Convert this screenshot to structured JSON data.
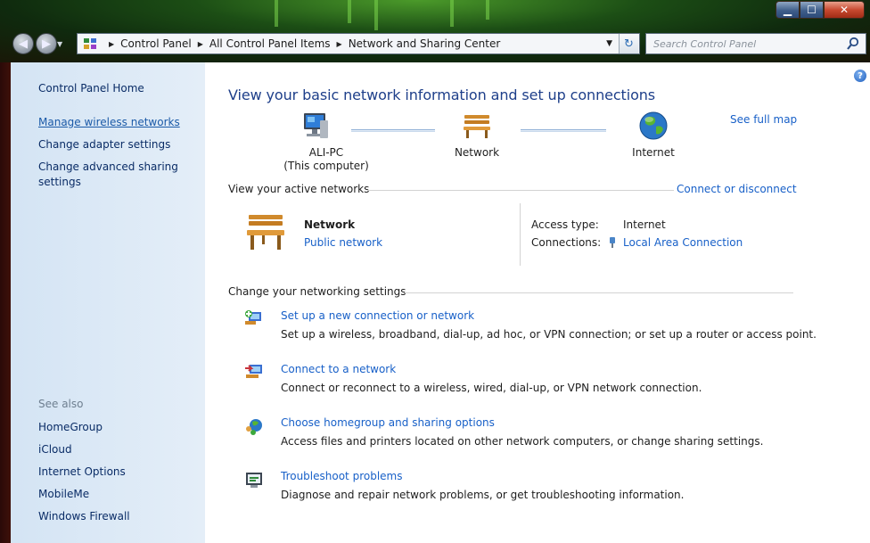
{
  "window": {
    "controls": {
      "minimize": "▁",
      "maximize": "☐",
      "close": "✕"
    }
  },
  "navigation": {
    "back_icon": "back-arrow-icon",
    "forward_icon": "forward-arrow-icon",
    "breadcrumb": [
      "Control Panel",
      "All Control Panel Items",
      "Network and Sharing Center"
    ],
    "search": {
      "placeholder": "Search Control Panel",
      "value": ""
    }
  },
  "sidebar": {
    "home": "Control Panel Home",
    "links": [
      "Manage wireless networks",
      "Change adapter settings",
      "Change advanced sharing settings"
    ],
    "see_also_label": "See also",
    "see_also": [
      "HomeGroup",
      "iCloud",
      "Internet Options",
      "MobileMe",
      "Windows Firewall"
    ]
  },
  "main": {
    "title": "View your basic network information and set up connections",
    "see_full_map": "See full map",
    "map": {
      "computer": {
        "name": "ALI-PC",
        "sub": "(This computer)"
      },
      "network": "Network",
      "internet": "Internet"
    },
    "active_networks": {
      "heading": "View your active networks",
      "connect_link": "Connect or disconnect",
      "network_name": "Network",
      "network_type": "Public network",
      "access_type_label": "Access type:",
      "access_type_value": "Internet",
      "connections_label": "Connections:",
      "connections_value": "Local Area Connection"
    },
    "settings": {
      "heading": "Change your networking settings",
      "tasks": [
        {
          "title": "Set up a new connection or network",
          "desc": "Set up a wireless, broadband, dial-up, ad hoc, or VPN connection; or set up a router or access point.",
          "icon": "new-connection-icon"
        },
        {
          "title": "Connect to a network",
          "desc": "Connect or reconnect to a wireless, wired, dial-up, or VPN network connection.",
          "icon": "connect-network-icon"
        },
        {
          "title": "Choose homegroup and sharing options",
          "desc": "Access files and printers located on other network computers, or change sharing settings.",
          "icon": "homegroup-icon"
        },
        {
          "title": "Troubleshoot problems",
          "desc": "Diagnose and repair network problems, or get troubleshooting information.",
          "icon": "troubleshoot-icon"
        }
      ]
    }
  },
  "colors": {
    "link": "#1860c8",
    "title": "#1e3f8a",
    "sidebar_bg": "#dbe8f5",
    "sidebar_text": "#0a2c66"
  }
}
